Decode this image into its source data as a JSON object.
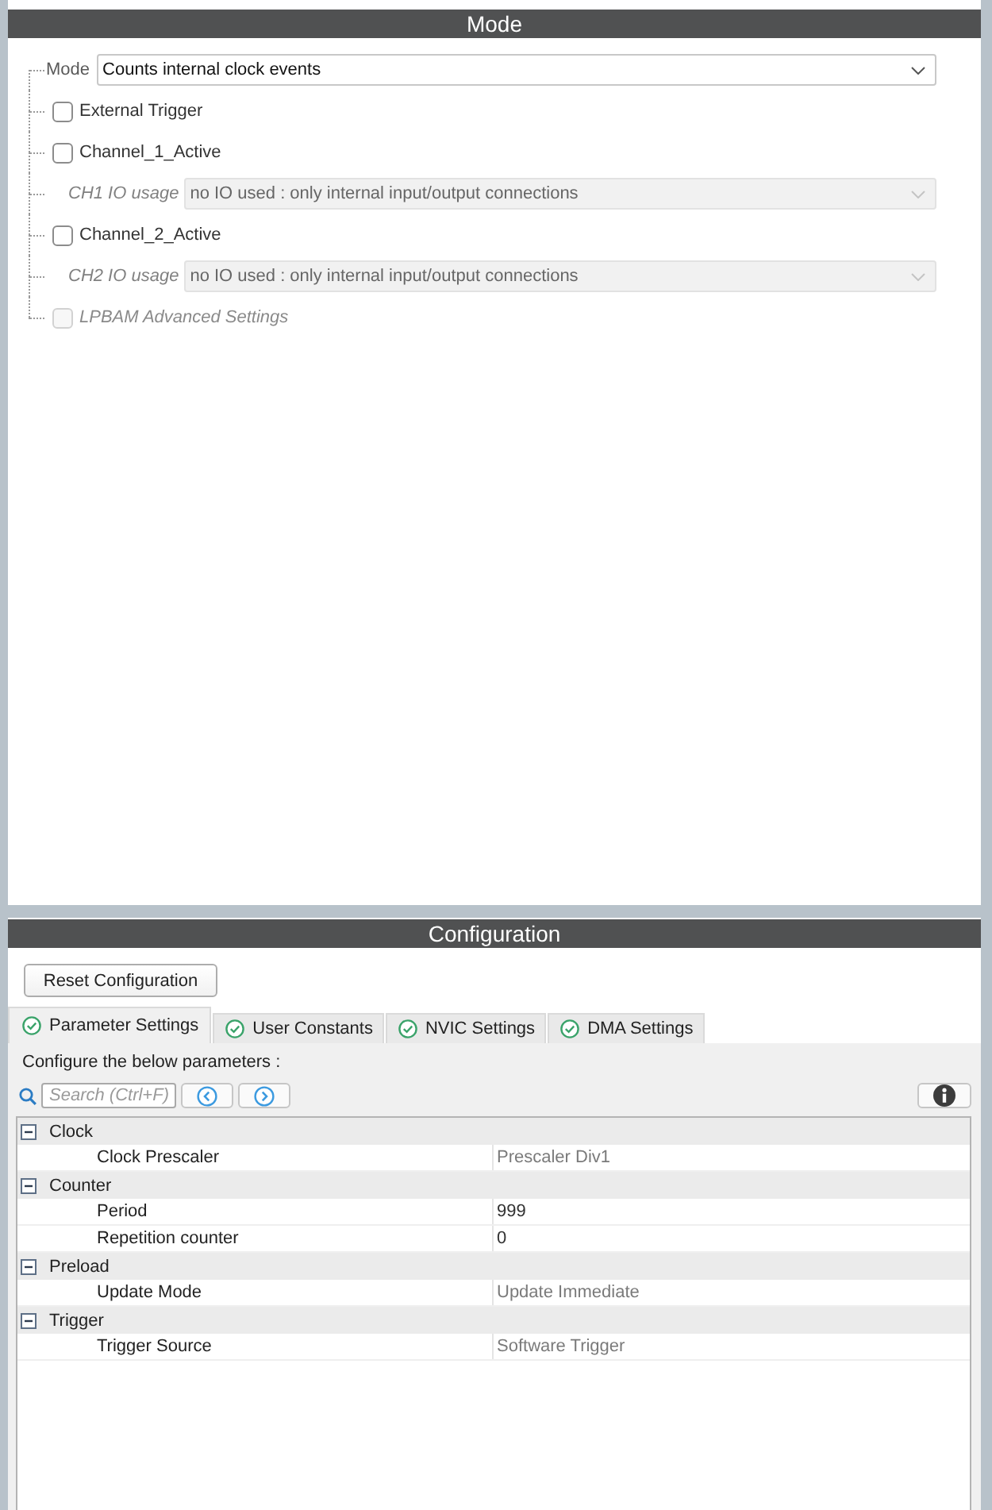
{
  "mode_panel": {
    "title": "Mode",
    "items": [
      {
        "kind": "select",
        "label": "Mode",
        "value": "Counts internal clock events",
        "disabled": false
      },
      {
        "kind": "checkbox",
        "label": "External Trigger",
        "checked": false,
        "disabled": false
      },
      {
        "kind": "checkbox",
        "label": "Channel_1_Active",
        "checked": false,
        "disabled": false
      },
      {
        "kind": "select",
        "label": "CH1 IO usage",
        "value": "no IO used : only internal input/output connections",
        "disabled": true
      },
      {
        "kind": "checkbox",
        "label": "Channel_2_Active",
        "checked": false,
        "disabled": false
      },
      {
        "kind": "select",
        "label": "CH2 IO usage",
        "value": "no IO used : only internal input/output connections",
        "disabled": true
      },
      {
        "kind": "checkbox",
        "label": "LPBAM Advanced Settings",
        "checked": false,
        "disabled": true
      }
    ]
  },
  "configuration_panel": {
    "title": "Configuration",
    "reset_button": "Reset Configuration",
    "tabs": [
      {
        "label": "Parameter Settings",
        "selected": true
      },
      {
        "label": "User Constants",
        "selected": false
      },
      {
        "label": "NVIC Settings",
        "selected": false
      },
      {
        "label": "DMA Settings",
        "selected": false
      }
    ],
    "hint": "Configure the below parameters :",
    "search": {
      "placeholder": "Search (Ctrl+F)"
    },
    "parameters": [
      {
        "group": "Clock",
        "expanded": true,
        "children": [
          {
            "name": "Clock Prescaler",
            "value": "Prescaler Div1",
            "kind": "choice"
          }
        ]
      },
      {
        "group": "Counter",
        "expanded": true,
        "children": [
          {
            "name": "Period",
            "value": "999",
            "kind": "number"
          },
          {
            "name": "Repetition counter",
            "value": "0",
            "kind": "number"
          }
        ]
      },
      {
        "group": "Preload",
        "expanded": true,
        "children": [
          {
            "name": "Update Mode",
            "value": "Update Immediate",
            "kind": "choice"
          }
        ]
      },
      {
        "group": "Trigger",
        "expanded": true,
        "children": [
          {
            "name": "Trigger Source",
            "value": "Software Trigger",
            "kind": "choice"
          }
        ]
      }
    ]
  }
}
